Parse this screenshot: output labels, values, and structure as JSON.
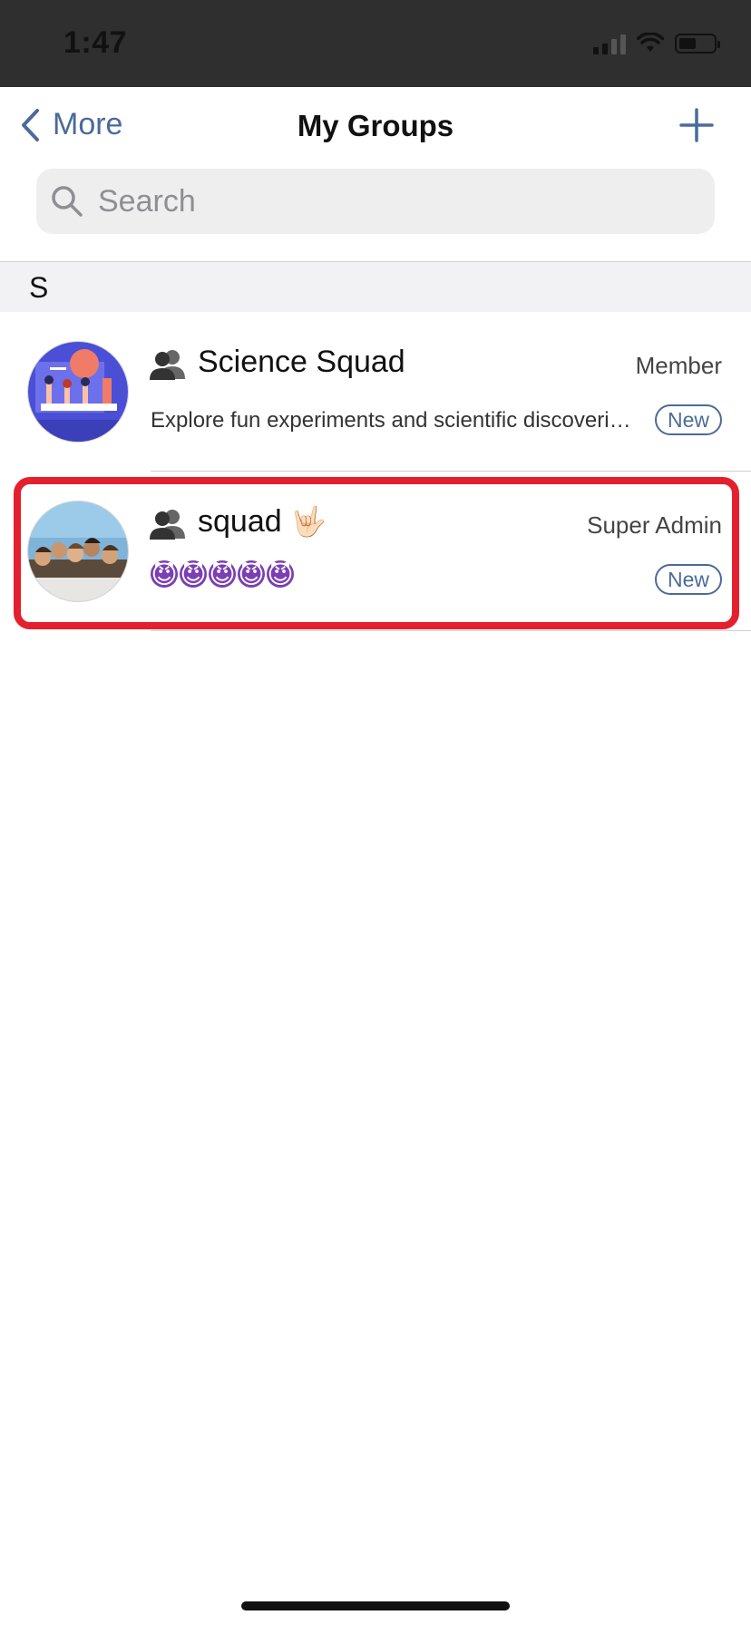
{
  "status_bar": {
    "time": "1:47"
  },
  "nav": {
    "back_label": "More",
    "title": "My Groups",
    "add_icon": "plus-icon"
  },
  "search": {
    "placeholder": "Search",
    "value": ""
  },
  "section": {
    "letter": "S"
  },
  "groups": [
    {
      "name": "Science Squad",
      "role": "Member",
      "description": "Explore fun experiments and scientific discoveri…",
      "badge": "New",
      "avatar": "science-illustration"
    },
    {
      "name": "squad",
      "role": "Super Admin",
      "name_emoji": "🤟🏻",
      "description_emoji": "😈",
      "description_emoji_count": 5,
      "badge": "New",
      "avatar": "group-photo"
    }
  ],
  "colors": {
    "accent": "#4a6b9a",
    "highlight": "#e5202e",
    "status_bar_bg": "#2f2f2f"
  }
}
